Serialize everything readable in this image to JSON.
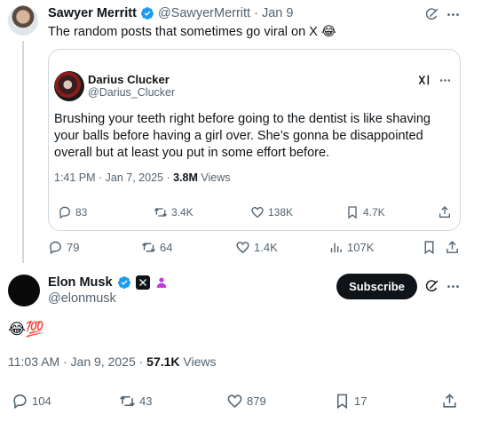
{
  "parent_post": {
    "author_name": "Sawyer Merritt",
    "author_handle": "@SawyerMerritt",
    "separator": "·",
    "date": "Jan 9",
    "text": "The random posts that sometimes go viral on X 😂",
    "actions": {
      "replies": "79",
      "reposts": "64",
      "likes": "1.4K",
      "views": "107K"
    }
  },
  "quoted_post": {
    "author_name": "Darius Clucker",
    "author_handle": "@Darius_Clucker",
    "text": "Brushing your teeth right before going to the dentist is like shaving your balls before having a girl over. She’s gonna be disappointed overall but at least you put in some effort before.",
    "timestamp": "1:41 PM · Jan 7, 2025 · ",
    "views_count": "3.8M",
    "views_label": " Views",
    "actions": {
      "replies": "83",
      "reposts": "3.4K",
      "likes": "138K",
      "bookmarks": "4.7K"
    }
  },
  "reply_post": {
    "author_name": "Elon Musk",
    "author_handle": "@elonmusk",
    "subscribe_label": "Subscribe",
    "text": "😂💯",
    "timestamp": "11:03 AM · Jan 9, 2025 · ",
    "views_count": "57.1K",
    "views_label": " Views",
    "actions": {
      "replies": "104",
      "reposts": "43",
      "likes": "879",
      "bookmarks": "17"
    }
  },
  "colors": {
    "verified_blue": "#1d9bf0",
    "text": "#0f1419",
    "muted": "#536471",
    "border": "#cfd9de",
    "affiliate_purple": "#c13ad8"
  },
  "icons": [
    "grok-icon",
    "more-icon",
    "reply-icon",
    "repost-icon",
    "like-icon",
    "views-icon",
    "bookmark-icon",
    "share-icon",
    "verified-icon",
    "x-affiliate-icon",
    "person-badge-icon"
  ]
}
